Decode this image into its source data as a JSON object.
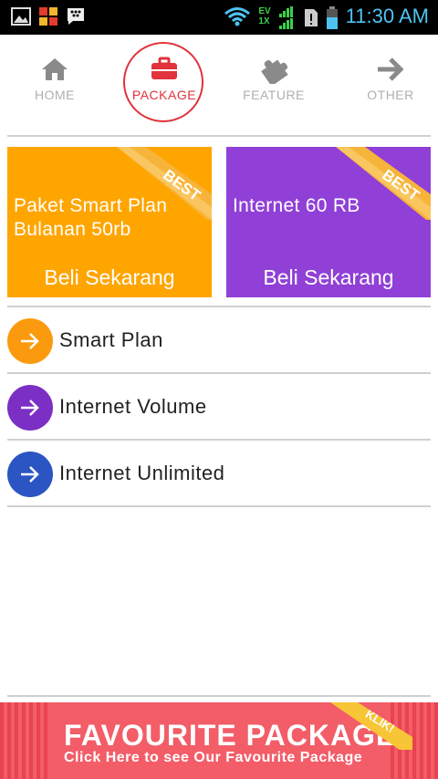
{
  "status_bar": {
    "time": "11:30 AM",
    "network_label_top": "EV",
    "network_label_bottom": "1X",
    "icons": [
      "gallery-icon",
      "app-grid-icon",
      "blackberry-messenger-icon",
      "wifi-icon",
      "signal-icon",
      "sim-alert-icon",
      "battery-icon"
    ]
  },
  "nav": {
    "items": [
      {
        "label": "HOME",
        "icon": "home-icon",
        "active": false
      },
      {
        "label": "PACKAGE",
        "icon": "briefcase-icon",
        "active": true
      },
      {
        "label": "FEATURE",
        "icon": "puzzle-icon",
        "active": false
      },
      {
        "label": "OTHER",
        "icon": "arrow-right-icon",
        "active": false
      }
    ]
  },
  "cards": [
    {
      "title": "Paket Smart Plan\nBulanan 50rb",
      "cta": "Beli Sekarang",
      "badge": "BEST",
      "color": "#ffa500"
    },
    {
      "title": "Internet 60 RB",
      "cta": "Beli Sekarang",
      "badge": "BEST",
      "color": "#9040d6"
    }
  ],
  "list": [
    {
      "label": "Smart Plan",
      "color": "#fb9a0e"
    },
    {
      "label": "Internet Volume",
      "color": "#7b2fc4"
    },
    {
      "label": "Internet Unlimited",
      "color": "#2b55c2"
    }
  ],
  "banner": {
    "title": "FAVOURITE PACKAGE",
    "subtitle": "Click Here to see Our Favourite Package",
    "badge": "KLIK!",
    "color": "#f25d68"
  }
}
